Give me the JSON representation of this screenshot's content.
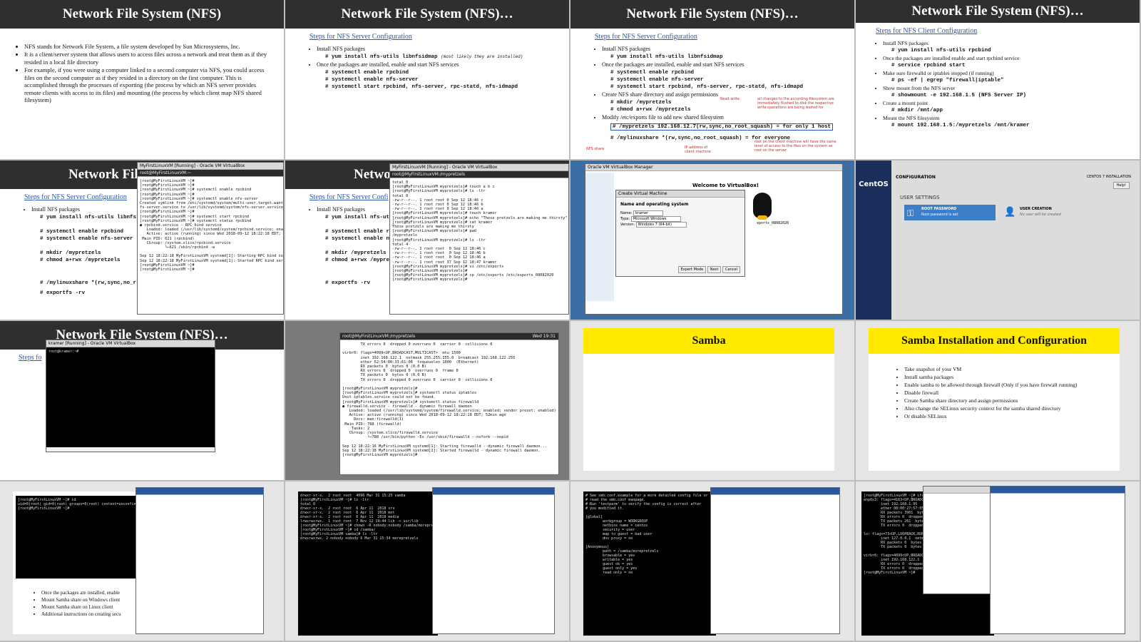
{
  "slides": {
    "c1": {
      "title": "Network File System (NFS)",
      "bullets": [
        "NFS stands for Network File System, a file system developed by Sun Microsystems, Inc.",
        "It is a client/server system that allows users to access files across a network and treat them as if they resided in a local file directory",
        "For example, if you were using a computer linked to a second computer via NFS, you could access files on the second computer as if they resided in a directory on the first computer. This is accomplished through the processes of exporting (the process by which an NFS server provides remote clients with access to its files) and mounting (the process by which client map NFS shared filesystem)"
      ]
    },
    "c2": {
      "title": "Network File System (NFS)…",
      "subtitle": "Steps for NFS Server Configuration",
      "l1": "Install NFS packages",
      "cmd1": "# yum install nfs-utils libnfsidmap",
      "cmd1_note": "(most likely they are installed)",
      "l2": "Once the packages are installed, enable and start NFS services",
      "cmd2": "# systemctl enable rpcbind",
      "cmd3": "# systemctl enable nfs-server",
      "cmd4": "# systemctl start rpcbind, nfs-server, rpc-statd, nfs-idmapd"
    },
    "c3": {
      "title": "Network File System (NFS)…",
      "subtitle": "Steps for NFS Server Configuration",
      "l3": "Create NFS share directory and assign permissions",
      "cmd5": "# mkdir /mypretzels",
      "cmd6": "# chmod a+rwx /mypretzels",
      "l4": "Modify /etc/exports file to add new shared filesystem",
      "cmd7": "# /mypretzels 192.168.12.7(rw,sync,no_root_squash) = for only 1 host",
      "cmd8": "# /mylinuxshare *(rw,sync,no_root_squash) = for everyone",
      "note_rw": "Read-write",
      "note_sync": "all changes to the according filesystem are immediately flushed to disk the respective write operations are being waited for",
      "note_share": "NFS share",
      "note_ip": "IP address of client machine",
      "note_root": "root on the client machine will have the same level of access to the files on the system as root on the server"
    },
    "c4": {
      "title": "Network File System (NFS)…",
      "subtitle": "Steps for NFS Client Configuration",
      "l1": "Install NFS packages",
      "cmd1": "# yum install nfs-utils rpcbind",
      "l2": "Once the packages are installed enable and start rpcbind service",
      "cmd2": "# service rpcbind start",
      "l3": "Make sure firewalld or iptables stopped (if running)",
      "cmd3": "# ps -ef | egrep \"firewall|iptable\"",
      "l4": "Show mount from the NFS server",
      "cmd4": "# showmount -e 192.168.1.5 (NFS Server IP)",
      "l5": "Create a mount point",
      "cmd5": "# mkdir /mnt/app",
      "l6": "Mount the NFS filesystem",
      "cmd6": "# mount 192.168.1.5:/mypretzels /mnt/kramer"
    },
    "c5": {
      "title": "Network File",
      "subtitle": "Steps for NFS Server Configuration",
      "l1": "Install NFS packages",
      "cmd1": "# yum install nfs-utils libnfs",
      "cmd5": "# systemctl enable rpcbind",
      "cmd6": "# systemctl enable nfs-server",
      "cmd7": "# mkdir /mypretzels",
      "cmd8": "# chmod a+rwx /mypretzels",
      "cmd9": "# /mylinuxshare *(rw,sync,no_r",
      "cmd10": "# exportfs -rv",
      "win_title": "MyFirstLinuxVM [Running] - Oracle VM VirtualBox",
      "term_title": "root@MyFirstLinuxVM:~",
      "term": "[root@MyFirstLinuxVM ~]#\n[root@MyFirstLinuxVM ~]#\n[root@MyFirstLinuxVM ~]# systemctl enable rpcbind\n[root@MyFirstLinuxVM ~]#\n[root@MyFirstLinuxVM ~]# systemctl enable nfs-server\nCreated symlink from /etc/systemd/system/multi-user.target.wants/n\nfs-server.service to /usr/lib/systemd/system/nfs-server.service.\n[root@MyFirstLinuxVM ~]#\n[root@MyFirstLinuxVM ~]# systemctl start rpcbind\n[root@MyFirstLinuxVM ~]# systemctl status rpcbind\n● rpcbind.service - RPC bind service\n   Loaded: loaded (/usr/lib/systemd/system/rpcbind.service; enabled\n   Active: active (running) since Wed 2018-09-12 18:22:18 EDT;\n Main PID: 621 (rpcbind)\n   CGroup: /system.slice/rpcbind.service\n           └─621 /sbin/rpcbind -w\n\nSep 12 18:22:18 MyFirstLinuxVM systemd[1]: Starting RPC bind servic\nSep 12 18:22:18 MyFirstLinuxVM systemd[1]: Started RPC bind service\n[root@MyFirstLinuxVM ~]#\n[root@MyFirstLinuxVM ~]#"
    },
    "c6": {
      "title": "Netwo",
      "subtitle": "Steps for NFS Server Confi",
      "term_title": "root@MyFirstLinuxVM:/mypretzels",
      "term": "total 0\n[root@MyFirstLinuxVM mypretzels]# touch a b c\n[root@MyFirstLinuxVM mypretzels]# ls -ltr\ntotal 0\n-rw-r--r--. 1 root root 0 Sep 12 18:46 c\n-rw-r--r--. 1 root root 0 Sep 12 18:46 b\n-rw-r--r--. 1 root root 0 Sep 12 18:46 a\n[root@MyFirstLinuxVM mypretzels]# touch kramer\n[root@MyFirstLinuxVM mypretzels]# echo \"These pretzels are making me thirsty\" > kramer\n[root@MyFirstLinuxVM mypretzels]# cat kramer\nThese pretzels are making me thirsty\n[root@MyFirstLinuxVM mypretzels]# pwd\n/mypretzels\n[root@MyFirstLinuxVM mypretzels]# ls -ltr\ntotal 4\n-rw-r--r--. 1 root root  0 Sep 12 18:46 c\n-rw-r--r--. 1 root root  0 Sep 12 18:46 b\n-rw-r--r--. 1 root root  0 Sep 12 18:46 a\n-rw-r--r--. 1 root root 37 Sep 12 18:47 kramer\n[root@MyFirstLinuxVM mypretzels]# vi /etc/exports\n[root@MyFirstLinuxVM mypretzels]#\n[root@MyFirstLinuxVM mypretzels]# cp /etc/exports /etc/exports_08082020\n[root@MyFirstLinuxVM mypretzels]#"
    },
    "c7": {
      "vbox_title": "Oracle VM VirtualBox Manager",
      "welcome": "Welcome to VirtualBox!",
      "dialog_title": "Create Virtual Machine",
      "dialog_heading": "Name and operating system",
      "field_name": "Name:",
      "field_name_val": "kramer",
      "field_type": "Type:",
      "field_type_val": "Microsoft Windows",
      "field_version": "Version:",
      "field_version_val": "Windows 7 (64-bit)",
      "btn_expert": "Expert Mode",
      "btn_next": "Next",
      "btn_cancel": "Cancel",
      "exports_frag": "xports_08082020"
    },
    "c8": {
      "brand": "CentOS",
      "config": "CONFIGURATION",
      "install": "CENTOS 7 INSTALLATION",
      "help": "Help!",
      "user_settings": "USER SETTINGS",
      "root_pw": "ROOT PASSWORD",
      "root_pw_sub": "Root password is set",
      "user_creation": "USER CREATION",
      "user_creation_sub": "No user will be created"
    },
    "c9": {
      "title": "Network File System (NFS)…",
      "subtitle_frag": "Steps fo",
      "win_title": "kramer [Running] - Oracle VM VirtualBox",
      "term": "root@kramer:~#"
    },
    "c10": {
      "term_title": "root@MyFirstLinuxVM:/mypretzels",
      "clock": "Wed 19:31",
      "term": "        TX errors 0  dropped 0 overruns 0  carrier 0  collisions 0\n\nvirbr0: flags=4099<UP,BROADCAST,MULTICAST>  mtu 1500\n        inet 192.168.122.1  netmask 255.255.255.0  broadcast 192.168.122.255\n        ether 52:54:00:33:61:08  txqueuelen 1000  (Ethernet)\n        RX packets 0  bytes 0 (0.0 B)\n        RX errors 0  dropped 0  overruns 0  frame 0\n        TX packets 0  bytes 0 (0.0 B)\n        TX errors 0  dropped 0 overruns 0  carrier 0  collisions 0\n\n[root@MyFirstLinuxVM mypretzels]#\n[root@MyFirstLinuxVM mypretzels]# systemctl status iptables\nUnit iptables.service could not be found.\n[root@MyFirstLinuxVM mypretzels]# systemctl status firewalld\n● firewalld.service - firewalld - dynamic firewall daemon\n   Loaded: loaded (/usr/lib/systemd/system/firewalld.service; enabled; vendor preset: enabled)\n   Active: active (running) since Wed 2018-09-12 18:22:18 EDT; 52min ago\n     Docs: man:firewalld(1)\n Main PID: 788 (firewalld)\n    Tasks: 2\n   CGroup: /system.slice/firewalld.service\n           └─788 /usr/bin/python -Es /usr/sbin/firewalld --nofork --nopid\n\nSep 12 18:22:16 MyFirstLinuxVM systemd[1]: Starting firewalld - dynamic firewall daemon...\nSep 12 18:22:18 MyFirstLinuxVM systemd[1]: Started firewalld - dynamic firewall daemon.\n[root@MyFirstLinuxVM mypretzels]#"
    },
    "c11": {
      "title": "Samba"
    },
    "c12": {
      "title": "Samba Installation and Configuration",
      "bullets": [
        "Take snapshot of your VM",
        "Install samba packages",
        "Enable samba to be allowed through firewall (Only if you have firewall running)",
        "Disable firewall",
        "Create Samba share directory and assign permissions",
        "Also change the SELinux security context for the samba shared directory",
        "Or disable SELinux"
      ]
    },
    "c13": {
      "term": "[root@MyFirstLinuxVM ~]# id\nuid=0(root) gid=0(root) groups=0(root) context=unconfined\n[root@MyFirstLinuxVM ~]#",
      "bullets": [
        "Once the packages are installed, enable",
        "Mount Samba share on Windows client",
        "Mount Samba share on Linux client",
        "Additional instructions on creating secu"
      ]
    },
    "c14": {
      "term": "drwxr-xr-x.  2 root root  4096 Mar 31 15:25 samba\n[root@MyFirstLinuxVM ~]# ls -ltr\ntotal 0\ndrwxr-xr-x.  2 root root  6 Apr 11  2018 srv\ndrwxr-xr-x.  2 root root  6 Apr 11  2018 mnt\ndrwxr-xr-x.  2 root root  6 Apr 11  2018 media\nlrwxrwxrwx.  1 root root  7 Nov 12 19:44 lib -> usr/lib\n[root@MyFirstLinuxVM ~]# chown -R nobody:nobody /samba/morepretzels\n[root@MyFirstLinuxVM ~]# cd /samba/\n[root@MyFirstLinuxVM samba]# ls -ltr\ndrwxrwxrwx. 2 nobody nobody 6 Mar 31 15:34 morepretzels"
    },
    "c15": {
      "term": "# See smb.conf.example for a more detailed config file or\n# read the smb.conf manpage.\n# Run 'testparm' to verify the config is correct after\n# you modified it.\n\n[global]\n        workgroup = WORKGROUP\n        netbios name = centos\n        security = user\n        map to guest = bad user\n        dns proxy = no\n\n[Anonymous]\n        path = /samba/morepretzels\n        browsable = yes\n        writable = yes\n        guest ok = yes\n        guest only = yes\n        read only = no"
    },
    "c16": {
      "term": "[root@MyFirstLinuxVM ~]# ifconfig\nenp0s3: flags=4163<UP,BROADCAST,RUNNING>\n        inet 192.168.1.95\n        ether 08:00:27:57:05\n        RX packets 3901  bytes\n        RX errors 0  dropped\n        TX packets 261  bytes\n        TX errors 0  dropped\n\nlo: flags=73<UP,LOOPBACK,RUNNING>\n        inet 127.0.0.1  netmask\n        RX packets 0  bytes 0\n        TX packets 0  bytes 0\n\nvirbr0: flags=4099<UP,BROADCAST>\n        inet 192.168.122.1\n        RX errors 0  dropped 0\n        TX errors 0  dropped 0 overruns 0  carrier 0  collisions 0\n[root@MyFirstLinuxVM ~]#"
    }
  },
  "colors": {
    "header": "#2f2f2f",
    "samba_header": "#ffea00",
    "link": "#2b57a8",
    "note": "#d22222"
  }
}
